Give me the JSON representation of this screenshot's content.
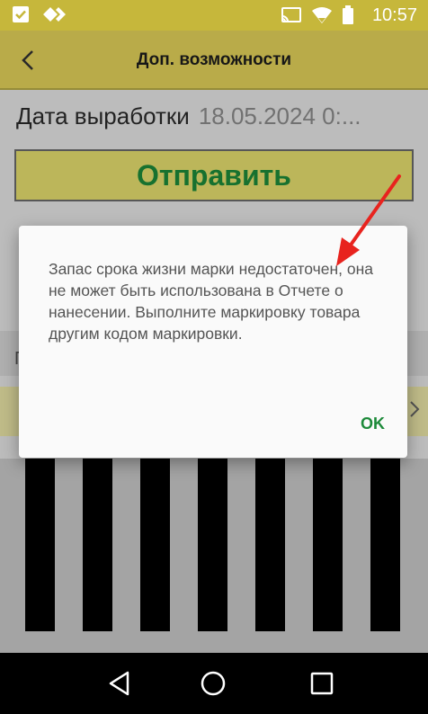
{
  "status_bar": {
    "time": "10:57",
    "left_icons": [
      "checkbox-icon",
      "diamond-icon"
    ],
    "right_icons": [
      "cast-icon",
      "wifi-icon",
      "battery-icon"
    ]
  },
  "app_bar": {
    "title": "Доп. возможности",
    "back_icon": "chevron-left-icon",
    "color": "#e2d15a"
  },
  "content": {
    "date_label": "Дата выработки",
    "date_value": "18.05.2024 0:...",
    "send_button_label": "Отправить",
    "row_label_partial": "П"
  },
  "dialog": {
    "message": "Запас срока жизни марки недостаточен, она не может быть использована в Отчете о нанесении. Выполните маркировку товара другим кодом маркировки.",
    "ok_label": "OK"
  },
  "colors": {
    "accent_green": "#1d8a3a",
    "annotation_red": "#e8231e",
    "app_yellow": "#e2d15a"
  },
  "nav_bar": {
    "icons": [
      "back-triangle-icon",
      "home-circle-icon",
      "recents-square-icon"
    ]
  }
}
